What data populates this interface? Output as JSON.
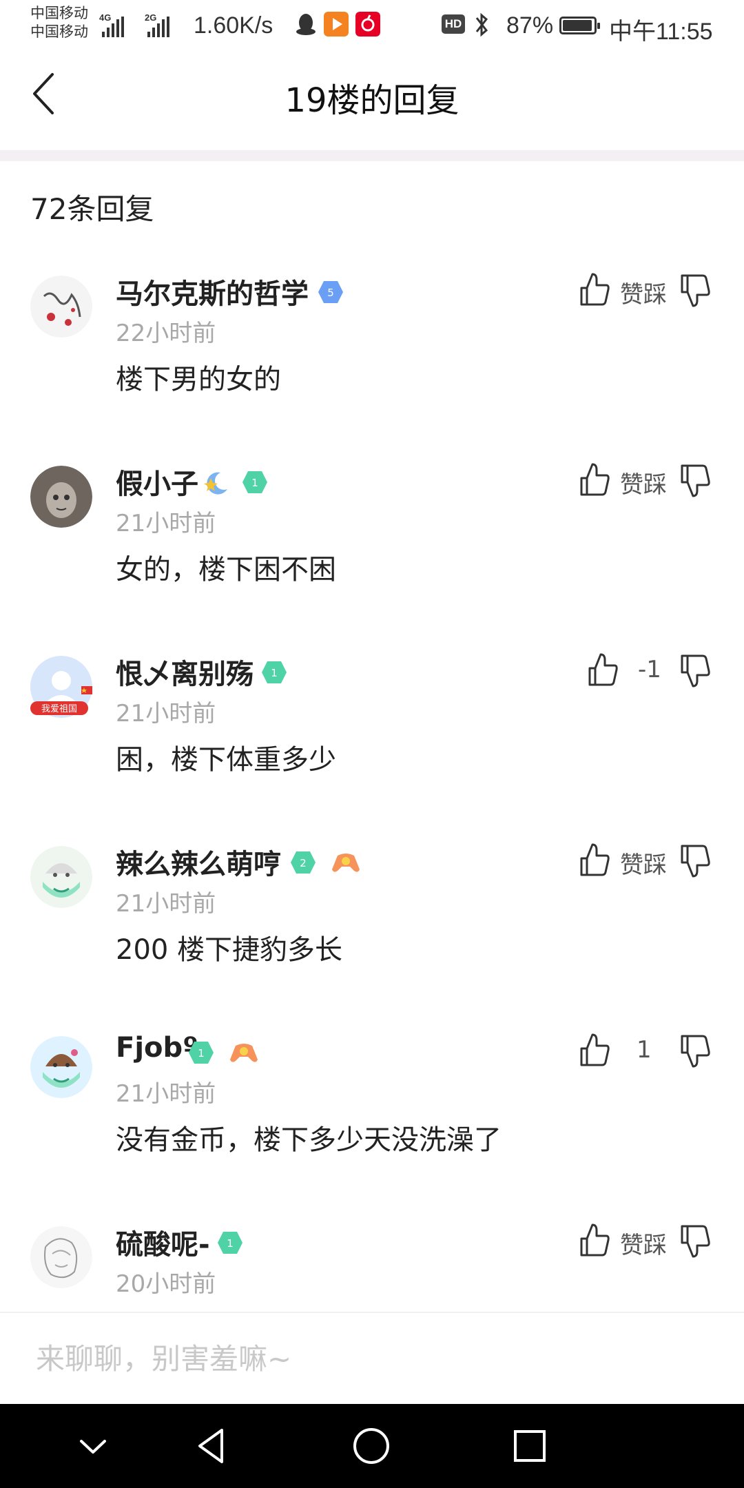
{
  "status_bar": {
    "carrier_1": "中国移动",
    "carrier_2": "中国移动",
    "network_1": "4G",
    "network_2": "2G",
    "net_speed": "1.60K/s",
    "hd_label": "HD",
    "battery": "87%",
    "time": "中午11:55",
    "app_icons": [
      "qq-penguin-icon",
      "video-app-icon",
      "netease-music-icon"
    ],
    "icons": [
      "bluetooth-icon",
      "battery-icon"
    ]
  },
  "header": {
    "title": "19楼的回复",
    "back_icon": "chevron-left-icon"
  },
  "reply_count": "72条回复",
  "replies": [
    {
      "username": "马尔克斯的哲学",
      "level": "5",
      "level_color": "#6b9ef5",
      "time": "22小时前",
      "content": "楼下男的女的",
      "vote_label": "赞踩"
    },
    {
      "username": "假小子",
      "level": "1",
      "level_color": "#4fd3a6",
      "time": "21小时前",
      "content": "女的，楼下困不困",
      "vote_label": "赞踩"
    },
    {
      "username": "恨乄离别殇",
      "level": "1",
      "level_color": "#4fd3a6",
      "time": "21小时前",
      "content": "困，楼下体重多少",
      "vote_label": "-1",
      "avatar_banner": "我爱祖国"
    },
    {
      "username": "辣么辣么萌哼",
      "level": "2",
      "level_color": "#4fd3a6",
      "time": "21小时前",
      "content": "200 楼下捷豹多长",
      "vote_label": "赞踩"
    },
    {
      "username": "Fjobº",
      "level": "1",
      "level_color": "#4fd3a6",
      "time": "21小时前",
      "content": "没有金币，楼下多少天没洗澡了",
      "vote_label": "1"
    },
    {
      "username": "硫酸呢-",
      "level": "1",
      "level_color": "#4fd3a6",
      "time": "20小时前",
      "content": "",
      "vote_label": "赞踩"
    }
  ],
  "input": {
    "placeholder": "来聊聊，别害羞嘛~"
  },
  "nav": {
    "icons": [
      "collapse-chevron-icon",
      "back-triangle-icon",
      "home-circle-icon",
      "recents-square-icon"
    ]
  },
  "colors": {
    "divider": "#f3eff3",
    "muted_text": "#a8a8a8",
    "level_blue": "#6b9ef5",
    "level_green": "#4fd3a6",
    "nav_bg": "#000000"
  }
}
